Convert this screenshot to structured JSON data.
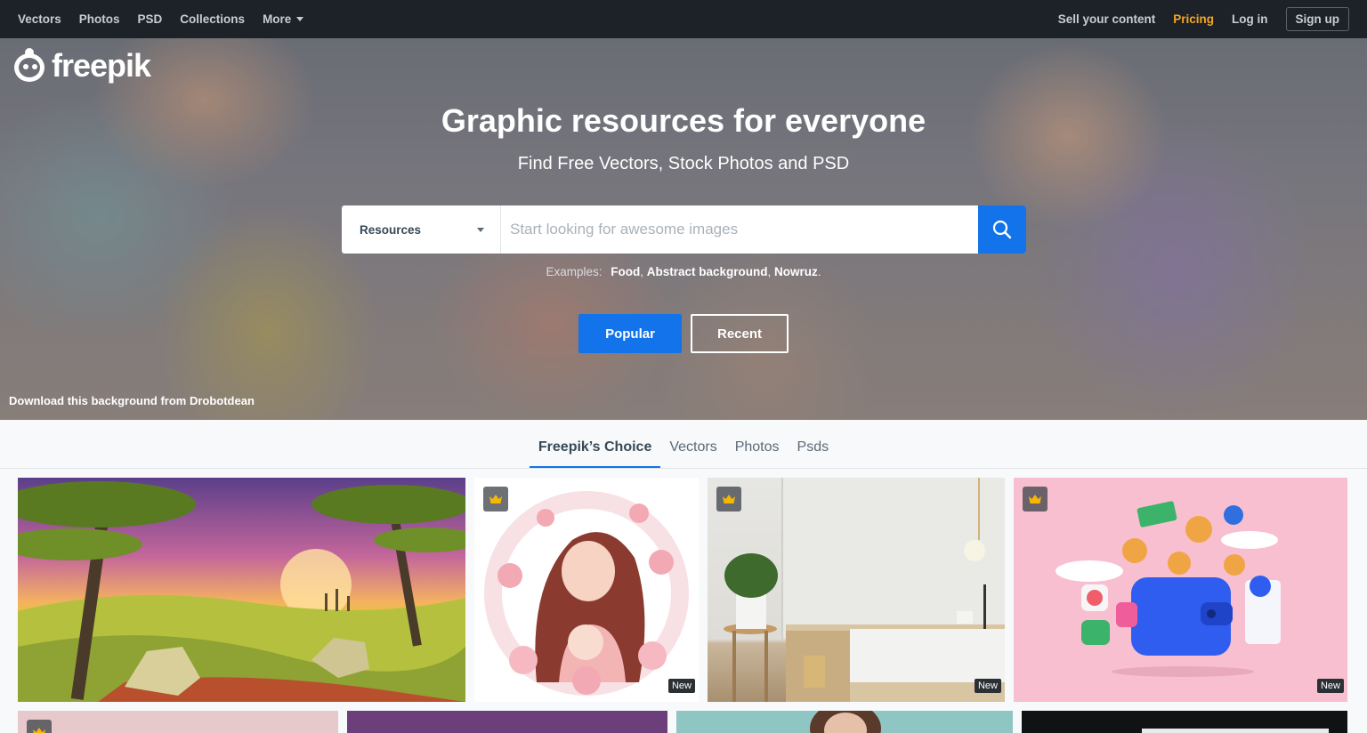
{
  "topnav": {
    "left": [
      "Vectors",
      "Photos",
      "PSD",
      "Collections"
    ],
    "more": "More",
    "sell": "Sell your content",
    "pricing": "Pricing",
    "login": "Log in",
    "signup": "Sign up"
  },
  "brand": {
    "name": "freepik"
  },
  "hero": {
    "title": "Graphic resources for everyone",
    "subtitle": "Find Free Vectors, Stock Photos and PSD",
    "credit": "Download this background from Drobotdean"
  },
  "search": {
    "category": "Resources",
    "placeholder": "Start looking for awesome images"
  },
  "examples": {
    "label": "Examples:",
    "items": [
      "Food",
      "Abstract background",
      "Nowruz"
    ]
  },
  "buttons": {
    "popular": "Popular",
    "recent": "Recent"
  },
  "tabs": [
    "Freepik’s Choice",
    "Vectors",
    "Photos",
    "Psds"
  ],
  "cards": {
    "new_label": "New"
  },
  "colors": {
    "accent": "#1273eb",
    "pricing": "#f5a623",
    "nav_bg": "#1d2228",
    "premium_crown": "#f5b800"
  }
}
